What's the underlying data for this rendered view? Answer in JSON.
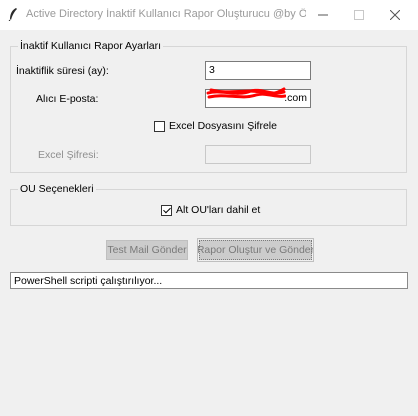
{
  "window": {
    "title": "Active Directory İnaktif Kullanıcı Rapor Oluşturucu @by Önde...",
    "icon": "feather-icon",
    "controls": [
      "minimize",
      "maximize",
      "close"
    ]
  },
  "settings_frame": {
    "title": "İnaktif Kullanıcı Rapor Ayarları",
    "inactivity_label": "İnaktiflik süresi (ay):",
    "inactivity_value": "3",
    "email_label": "Alıcı E-posta:",
    "email_value_visible": ".com",
    "encrypt_label": "Excel Dosyasını Şifrele",
    "encrypt_checked": false,
    "password_label": "Excel Şifresi:",
    "password_value": ""
  },
  "ou_frame": {
    "title": "OU Seçenekleri",
    "include_sub_label": "Alt OU'ları dahil et",
    "include_sub_checked": true
  },
  "buttons": {
    "test_mail": "Test Mail Gönder",
    "generate": "Rapor Oluştur ve Gönder"
  },
  "status": {
    "text": "PowerShell scripti çalıştırılıyor..."
  },
  "colors": {
    "window_bg": "#f0f0f0",
    "redaction": "#ff0000",
    "disabled_text": "#8e8e8e",
    "disabled_button_bg": "#cccccc"
  }
}
